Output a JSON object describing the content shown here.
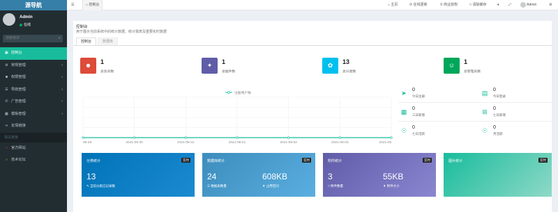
{
  "sidebar": {
    "logo": "源导航",
    "user": {
      "name": "Admin",
      "status": "在线"
    },
    "search_placeholder": "搜索菜单",
    "items": [
      {
        "label": "控制台",
        "icon": "dashboard-icon",
        "active": true
      },
      {
        "label": "常规管理",
        "icon": "cogs-icon",
        "active": false
      },
      {
        "label": "权限管理",
        "icon": "group-icon",
        "active": false
      },
      {
        "label": "导航管理",
        "icon": "list-icon",
        "active": false
      },
      {
        "label": "广告管理",
        "icon": "bullhorn-icon",
        "active": false
      },
      {
        "label": "模板管理",
        "icon": "template-icon",
        "active": false
      },
      {
        "label": "友情链接",
        "icon": "link-icon",
        "active": false
      }
    ],
    "section_header": "相关链接",
    "links": [
      {
        "label": "官方网站",
        "icon": "circle-icon"
      },
      {
        "label": "技术论坛",
        "icon": "circle-icon"
      }
    ]
  },
  "topbar": {
    "breadcrumb": "控制台",
    "nav": [
      "主页",
      "在线更新",
      "商业授权",
      "清除缓存"
    ],
    "admin": "Admin"
  },
  "panel": {
    "title": "控制台",
    "subtitle": "用于展示当前系统中的统计数据、统计报表及重要实时数据",
    "tabs": [
      "控制台",
      "数据库"
    ]
  },
  "stats": [
    {
      "value": "1",
      "label": "总会员数",
      "color": "#dd4b39",
      "icon": "users-icon"
    },
    {
      "value": "1",
      "label": "总插件数",
      "color": "#605ca8",
      "icon": "magic-icon"
    },
    {
      "value": "13",
      "label": "总分类数",
      "color": "#00c0ef",
      "icon": "leaf-icon"
    },
    {
      "value": "1",
      "label": "总管理员数",
      "color": "#00a65a",
      "icon": "user-icon"
    }
  ],
  "chart_data": {
    "type": "line",
    "legend": "注册用户数",
    "categories": [
      "08-29",
      "2021-08-30",
      "2021-08-31",
      "2021-09-01",
      "2021-09-02",
      "2021-09-03",
      "2021-09"
    ],
    "series": [
      {
        "name": "注册用户数",
        "values": [
          0,
          0,
          0,
          0,
          0,
          0,
          0
        ]
      }
    ],
    "color": "#18bc9c"
  },
  "mini_stats": [
    {
      "value": "0",
      "label": "今日注册",
      "icon": "paper-plane-icon"
    },
    {
      "value": "0",
      "label": "今日登录",
      "icon": "id-card-icon"
    },
    {
      "value": "0",
      "label": "三日新增",
      "icon": "calendar-icon"
    },
    {
      "value": "0",
      "label": "七日新增",
      "icon": "calendar-plus-icon"
    },
    {
      "value": "0",
      "label": "七日活跃",
      "icon": "user-circle-icon"
    },
    {
      "value": "0",
      "label": "月活跃",
      "icon": "user-circle-icon"
    }
  ],
  "cards": [
    {
      "title": "分类统计",
      "tag": "实时",
      "values": [
        {
          "num": "13",
          "label": "当前分类已记录数"
        }
      ],
      "color": "#0073b7"
    },
    {
      "title": "数据库统计",
      "tag": "实时",
      "values": [
        {
          "num": "24",
          "label": "数据表数量"
        },
        {
          "num": "608KB",
          "label": "占用空间"
        }
      ],
      "color": "#3c8dbc"
    },
    {
      "title": "附件统计",
      "tag": "实时",
      "values": [
        {
          "num": "3",
          "label": "附件数量"
        },
        {
          "num": "55KB",
          "label": "附件大小"
        }
      ],
      "color": "#605ca8"
    },
    {
      "title": "图片统计",
      "tag": "实时",
      "values": [
        {
          "num": "",
          "label": ""
        }
      ],
      "color": "#18bc9c"
    }
  ]
}
